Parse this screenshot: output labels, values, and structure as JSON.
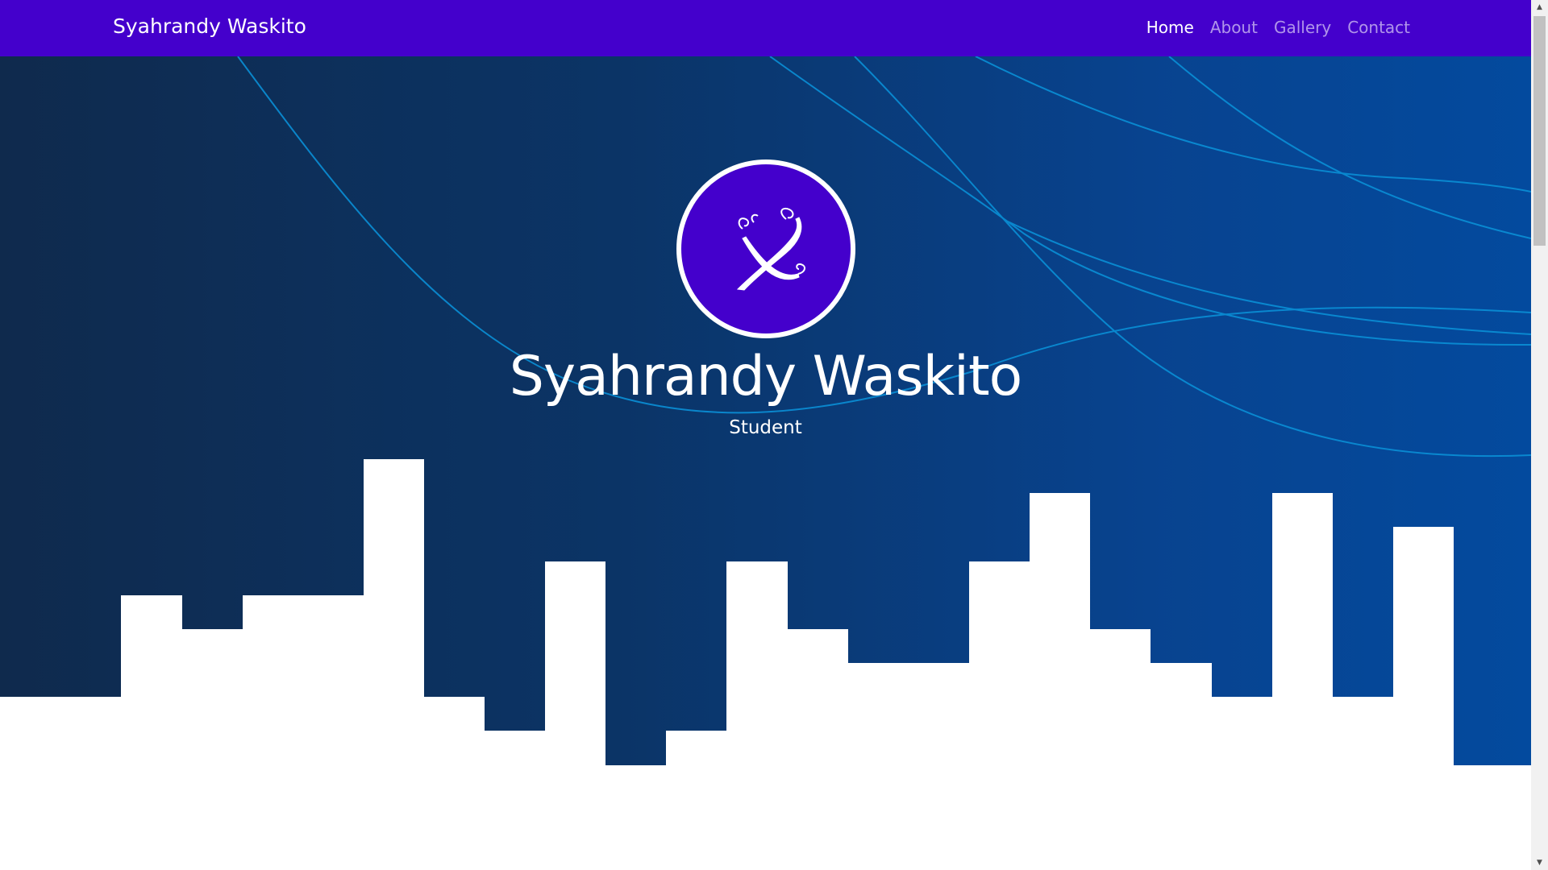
{
  "navbar": {
    "brand": "Syahrandy Waskito",
    "links": [
      {
        "label": "Home",
        "active": true
      },
      {
        "label": "About",
        "active": false
      },
      {
        "label": "Gallery",
        "active": false
      },
      {
        "label": "Contact",
        "active": false
      }
    ]
  },
  "hero": {
    "title": "Syahrandy Waskito",
    "subtitle": "Student",
    "avatar_icon": "stylized-x-logo-icon"
  },
  "colors": {
    "navbar": "#4400cc",
    "hero_gradient_start": "#0f2a4d",
    "hero_gradient_end": "#034a9e",
    "curve_lines": "#0a8fd6",
    "skyline": "#ffffff"
  },
  "scrollbar": {
    "up_icon": "chevron-up-icon",
    "down_icon": "chevron-down-icon"
  }
}
